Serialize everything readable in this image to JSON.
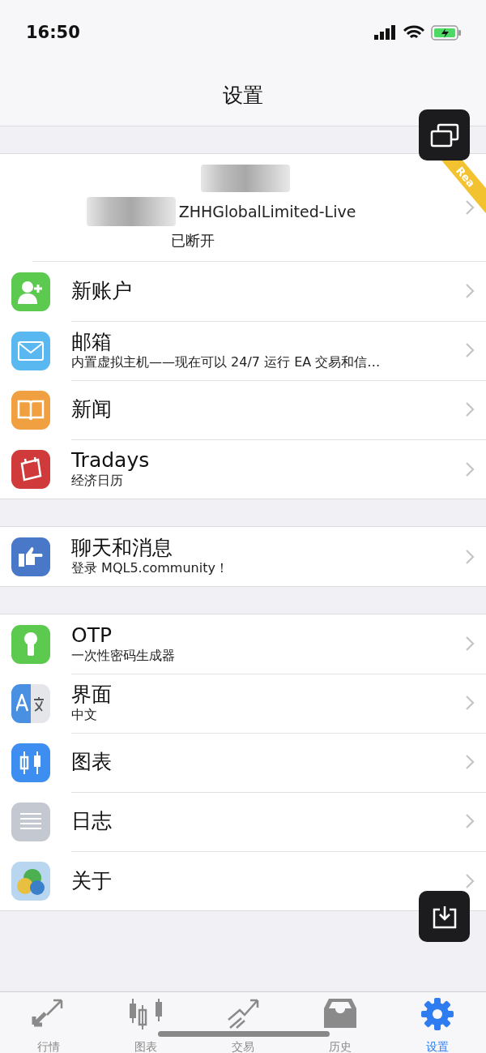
{
  "status_bar": {
    "time": "16:50"
  },
  "nav": {
    "title": "设置"
  },
  "account": {
    "server": "ZHHGlobalLimited-Live",
    "status": "已断开",
    "ribbon": "Rea"
  },
  "groups": [
    {
      "items": [
        {
          "kind": "person",
          "color": "#5cc94f",
          "title": "新账户"
        },
        {
          "kind": "mail",
          "color": "#5ab8f0",
          "title": "邮箱",
          "subtitle": "内置虚拟主机——现在可以 24/7 运行 EA 交易和信…"
        },
        {
          "kind": "book",
          "color": "#f0a040",
          "title": "新闻"
        },
        {
          "kind": "calendar",
          "color": "#d03a3a",
          "title": "Tradays",
          "subtitle": "经济日历"
        }
      ]
    },
    {
      "items": [
        {
          "kind": "hand",
          "color": "#4a78c8",
          "title": "聊天和消息",
          "subtitle": "登录 MQL5.community！"
        }
      ]
    },
    {
      "items": [
        {
          "kind": "key",
          "color": "#5cc94f",
          "title": "OTP",
          "subtitle": "一次性密码生成器"
        },
        {
          "kind": "translate",
          "color": "#4a90e2",
          "title": "界面",
          "subtitle": "中文"
        },
        {
          "kind": "candles",
          "color": "#3d8ef0",
          "title": "图表"
        },
        {
          "kind": "lines",
          "color": "#c4c8d0",
          "title": "日志"
        },
        {
          "kind": "logo",
          "color": "#b8d6f0",
          "title": "关于"
        }
      ]
    }
  ],
  "tabs": [
    {
      "kind": "arrows",
      "label": "行情",
      "selected": false
    },
    {
      "kind": "candles",
      "label": "图表",
      "selected": false
    },
    {
      "kind": "trend",
      "label": "交易",
      "selected": false
    },
    {
      "kind": "inbox",
      "label": "历史",
      "selected": false
    },
    {
      "kind": "gear",
      "label": "设置",
      "selected": true
    }
  ]
}
